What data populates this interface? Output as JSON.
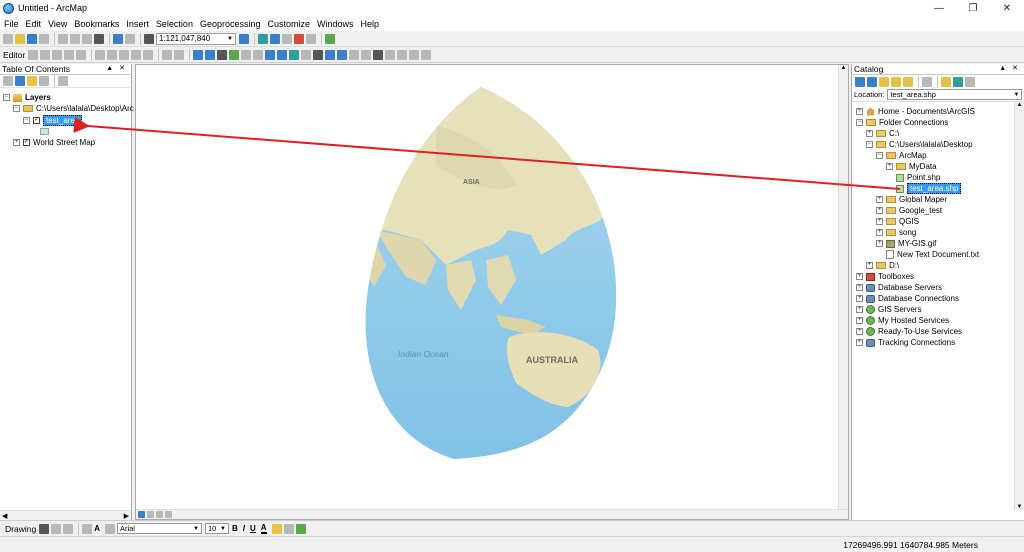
{
  "window": {
    "title": "Untitled - ArcMap"
  },
  "menu": [
    "File",
    "Edit",
    "View",
    "Bookmarks",
    "Insert",
    "Selection",
    "Geoprocessing",
    "Customize",
    "Windows",
    "Help"
  ],
  "toolbar": {
    "scale": "1:121,047,840",
    "editor_label": "Editor"
  },
  "toc": {
    "title": "Table Of Contents",
    "layers_label": "Layers",
    "folder_path": "C:\\Users\\lalala\\Desktop\\Arc",
    "selected_layer": "test_area",
    "basemap": "World Street Map"
  },
  "map": {
    "labels": {
      "asia": "ASIA",
      "indian_ocean": "Indian Ocean",
      "australia": "AUSTRALIA"
    },
    "colors": {
      "ocean": "#8ec9ea",
      "land": "#e6e0bb",
      "arrow": "#e02020"
    }
  },
  "catalog": {
    "title": "Catalog",
    "location_label": "Location:",
    "location_value": "test_area.shp",
    "items": {
      "home": "Home - Documents\\ArcGIS",
      "folder_connections": "Folder Connections",
      "c_drive": "C:\\",
      "desktop": "C:\\Users\\lalala\\Desktop",
      "arcmap": "ArcMap",
      "mydata": "MyData",
      "point": "Point.shp",
      "test_area": "test_area.shp",
      "global_mapper": "Global Maper",
      "google_test": "Google_test",
      "qgis": "QGIS",
      "song": "song",
      "my_gis": "MY-GIS.gif",
      "new_text": "New Text Document.txt",
      "d_drive": "D:\\",
      "toolboxes": "Toolboxes",
      "db_servers": "Database Servers",
      "db_connections": "Database Connections",
      "gis_servers": "GIS Servers",
      "hosted": "My Hosted Services",
      "ready": "Ready-To-Use Services",
      "tracking": "Tracking Connections"
    }
  },
  "drawing": {
    "label": "Drawing",
    "font": "Arial",
    "size": "10",
    "bold": "B",
    "italic": "I",
    "underline": "U",
    "font_color": "A"
  },
  "status": {
    "coordinates": "17269496.991  1640784.985 Meters"
  }
}
